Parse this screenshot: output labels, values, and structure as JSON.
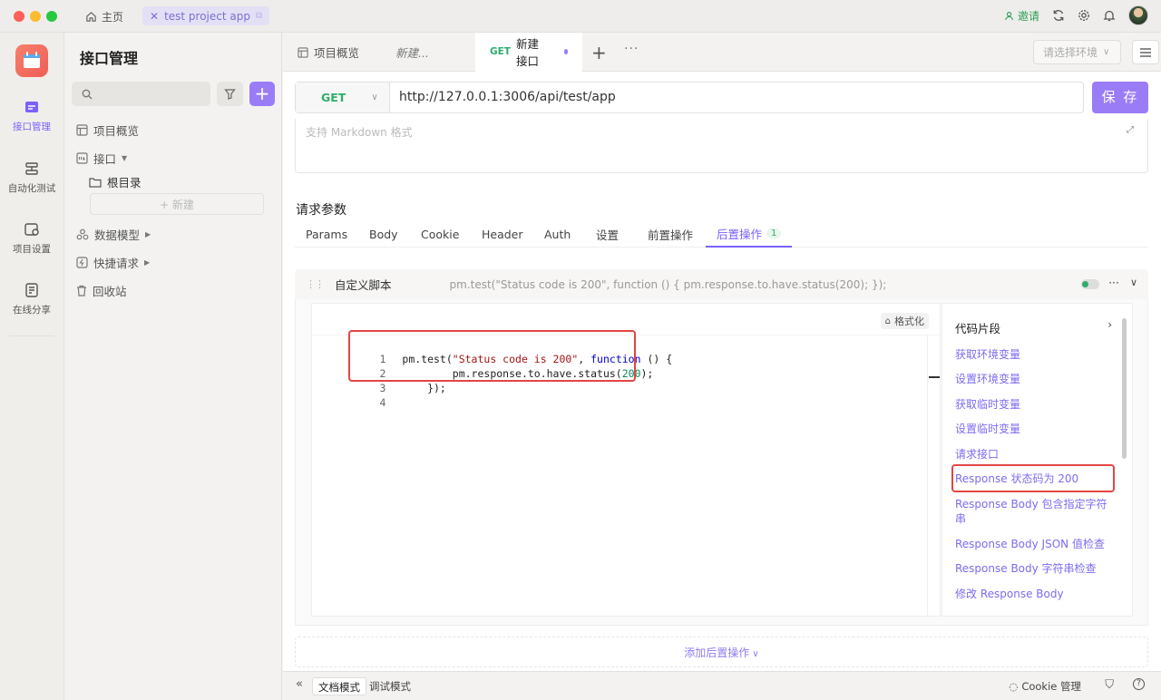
{
  "titlebar": {
    "home_label": "主页",
    "project_tab_label": "test project app",
    "invite_label": "邀请"
  },
  "iconbar": {
    "items": [
      {
        "label": "接口管理",
        "icon": "api-management-icon",
        "active": true
      },
      {
        "label": "自动化测试",
        "icon": "automation-test-icon",
        "active": false
      },
      {
        "label": "项目设置",
        "icon": "project-settings-icon",
        "active": false
      },
      {
        "label": "在线分享",
        "icon": "share-icon",
        "active": false
      }
    ]
  },
  "sidebar": {
    "title": "接口管理",
    "search_placeholder": "",
    "tree": {
      "overview": "项目概览",
      "api": "接口",
      "root_dir": "根目录",
      "new_label": "+ 新建",
      "data_model": "数据模型",
      "quick_request": "快捷请求",
      "recycle_bin": "回收站"
    }
  },
  "main": {
    "tabs": [
      {
        "label": "项目概览"
      },
      {
        "label": "新建..."
      },
      {
        "method": "GET",
        "label": "新建接口",
        "active": true
      }
    ],
    "env_placeholder": "请选择环境",
    "request": {
      "method": "GET",
      "url": "http://127.0.0.1:3006/api/test/app",
      "save_label": "保 存"
    },
    "description_placeholder": "支持 Markdown 格式",
    "params_title": "请求参数",
    "param_tabs": [
      {
        "label": "Params"
      },
      {
        "label": "Body"
      },
      {
        "label": "Cookie"
      },
      {
        "label": "Header"
      },
      {
        "label": "Auth"
      },
      {
        "label": "设置"
      },
      {
        "label": "前置操作"
      },
      {
        "label": "后置操作",
        "badge": "1",
        "active": true
      }
    ],
    "script": {
      "title": "自定义脚本",
      "preview": "pm.test(\"Status code is 200\", function () { pm.response.to.have.status(200); });",
      "format_label": "格式化",
      "code_lines": [
        {
          "n": "1",
          "text": "pm.test(\"Status code is 200\", function () {"
        },
        {
          "n": "2",
          "text": "        pm.response.to.have.status(200);"
        },
        {
          "n": "3",
          "text": "    });"
        },
        {
          "n": "4",
          "text": ""
        }
      ]
    },
    "snippets": {
      "title": "代码片段",
      "items": [
        "获取环境变量",
        "设置环境变量",
        "获取临时变量",
        "设置临时变量",
        "请求接口",
        "Response 状态码为 200",
        "Response Body 包含指定字符串",
        "Response Body JSON 值检查",
        "Response Body 字符串检查",
        "修改 Response Body"
      ]
    },
    "add_post_label": "添加后置操作"
  },
  "footer": {
    "doc_mode": "文档模式",
    "debug_mode": "调试模式",
    "cookie_label": "Cookie 管理"
  },
  "colors": {
    "accent": "#9b7cf7",
    "get_method": "#2ead6b",
    "highlight_box": "#e34543"
  }
}
